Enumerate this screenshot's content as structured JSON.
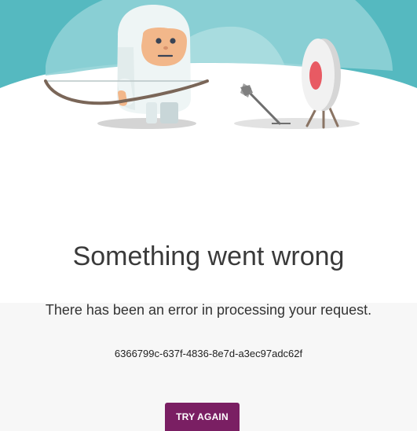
{
  "error": {
    "title": "Something went wrong",
    "message": "There has been an error in processing your request.",
    "error_id": "6366799c-637f-4836-8e7d-a3ec97adc62f"
  },
  "actions": {
    "try_again_label": "TRY AGAIN"
  },
  "illustration": {
    "icon": "yeti-archer-illustration",
    "colors": {
      "sky": "#55b9c0",
      "button": "#7a1f63",
      "target_center": "#e85a63"
    }
  }
}
